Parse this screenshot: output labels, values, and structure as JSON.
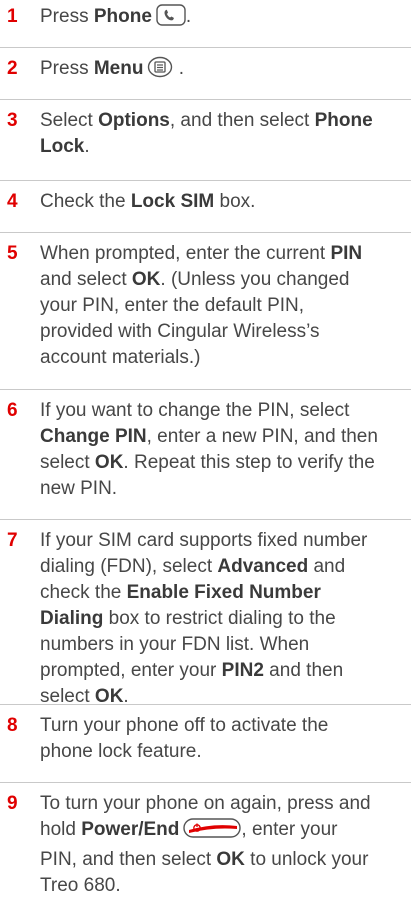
{
  "steps": [
    {
      "number": "1",
      "lines": [
        [
          "Press ",
          {
            "b": "Phone"
          },
          {
            "icon": "phone-key-icon"
          },
          "."
        ]
      ]
    },
    {
      "number": "2",
      "lines": [
        [
          "Press ",
          {
            "b": "Menu"
          },
          {
            "icon": "menu-key-icon"
          },
          " ."
        ]
      ]
    },
    {
      "number": "3",
      "lines": [
        [
          "Select ",
          {
            "b": "Options"
          },
          ", and then select ",
          {
            "b": "Phone"
          }
        ],
        [
          {
            "b": "Lock"
          },
          "."
        ]
      ]
    },
    {
      "number": "4",
      "lines": [
        [
          "Check the ",
          {
            "b": "Lock SIM"
          },
          " box."
        ]
      ]
    },
    {
      "number": "5",
      "lines": [
        [
          "When prompted, enter the current ",
          {
            "b": "PIN"
          }
        ],
        [
          "and select ",
          {
            "b": "OK"
          },
          ". (Unless you changed"
        ],
        [
          "your  PIN, enter the default PIN,"
        ],
        [
          "provided with Cingular Wireless’s"
        ],
        [
          "account  materials.)"
        ]
      ]
    },
    {
      "number": "6",
      "lines": [
        [
          "If you want to change the PIN, select"
        ],
        [
          {
            "b": "Change PIN"
          },
          ", enter a new PIN, and then"
        ],
        [
          "select ",
          {
            "b": "OK"
          },
          ". Repeat this step to verify the"
        ],
        [
          "new PIN."
        ]
      ]
    },
    {
      "number": "7",
      "lines": [
        [
          "If your SIM card supports fixed number"
        ],
        [
          "dialing (FDN), select ",
          {
            "b": "Advanced"
          },
          " and"
        ],
        [
          "check the ",
          {
            "b": "Enable Fixed Number"
          }
        ],
        [
          {
            "b": "Dialing"
          },
          " box to restrict dialing to the"
        ],
        [
          "numbers in your FDN list. When"
        ],
        [
          "prompted, enter your ",
          {
            "b": "PIN2"
          },
          " and then"
        ],
        [
          "select ",
          {
            "b": "OK"
          },
          "."
        ]
      ]
    },
    {
      "number": "8",
      "lines": [
        [
          "Turn your phone off to activate the"
        ],
        [
          "phone lock feature."
        ]
      ]
    },
    {
      "number": "9",
      "lines": [
        [
          "To turn your phone on again, press and"
        ],
        [
          "hold ",
          {
            "b": "Power/End"
          },
          {
            "icon": "power-end-key-icon"
          },
          ", enter your"
        ],
        [
          "PIN, and then select ",
          {
            "b": "OK"
          },
          " to unlock your"
        ],
        [
          "Treo 680."
        ]
      ]
    }
  ],
  "colors": {
    "number": "#e00000",
    "text": "#474747",
    "rule": "#c9c9c9",
    "power_key": "#e00000"
  }
}
